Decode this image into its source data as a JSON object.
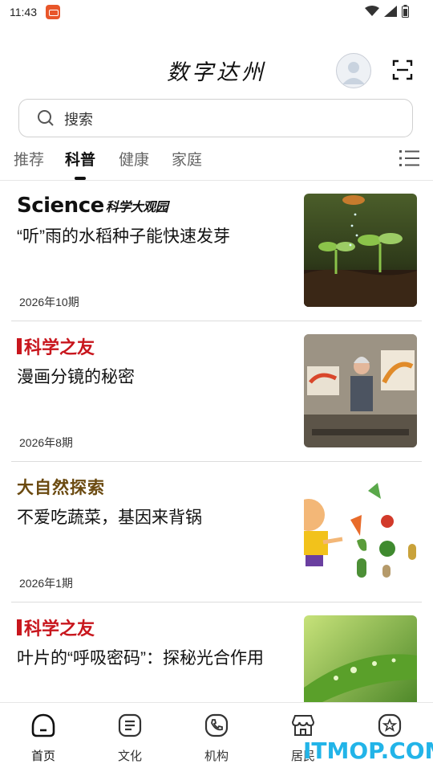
{
  "status_bar": {
    "time": "11:43"
  },
  "header": {
    "title": "数字达州"
  },
  "search": {
    "placeholder": "搜索"
  },
  "tabs": [
    {
      "label": "推荐"
    },
    {
      "label": "科普"
    },
    {
      "label": "健康"
    },
    {
      "label": "家庭"
    }
  ],
  "active_tab": "科普",
  "articles": [
    {
      "brand": "Science",
      "brand_sub": "科学大观园",
      "headline": "“听”雨的水稻种子能快速发芽",
      "issue": "2026年10期",
      "thumb_icon": "seedling-photo"
    },
    {
      "brand": "科学之友",
      "headline": "漫画分镜的秘密",
      "issue": "2026年8期",
      "thumb_icon": "artist-photo"
    },
    {
      "brand": "大自然探索",
      "headline": "不爱吃蔬菜，基因来背锅",
      "issue": "2026年1期",
      "thumb_icon": "vegetables-cartoon"
    },
    {
      "brand": "科学之友",
      "headline": "叶片的“呼吸密码”：探秘光合作用",
      "issue": "",
      "thumb_icon": "leaf-photo"
    }
  ],
  "bottom_nav": [
    {
      "label": "首页",
      "icon": "home-icon"
    },
    {
      "label": "文化",
      "icon": "culture-icon"
    },
    {
      "label": "机构",
      "icon": "phone-icon"
    },
    {
      "label": "居民",
      "icon": "shop-icon"
    },
    {
      "label": "",
      "icon": "star-icon"
    }
  ],
  "watermark": "ITMOP.COM",
  "colors": {
    "accent": "#111111",
    "brand_red": "#c8161d",
    "watermark": "#22b4e8"
  }
}
